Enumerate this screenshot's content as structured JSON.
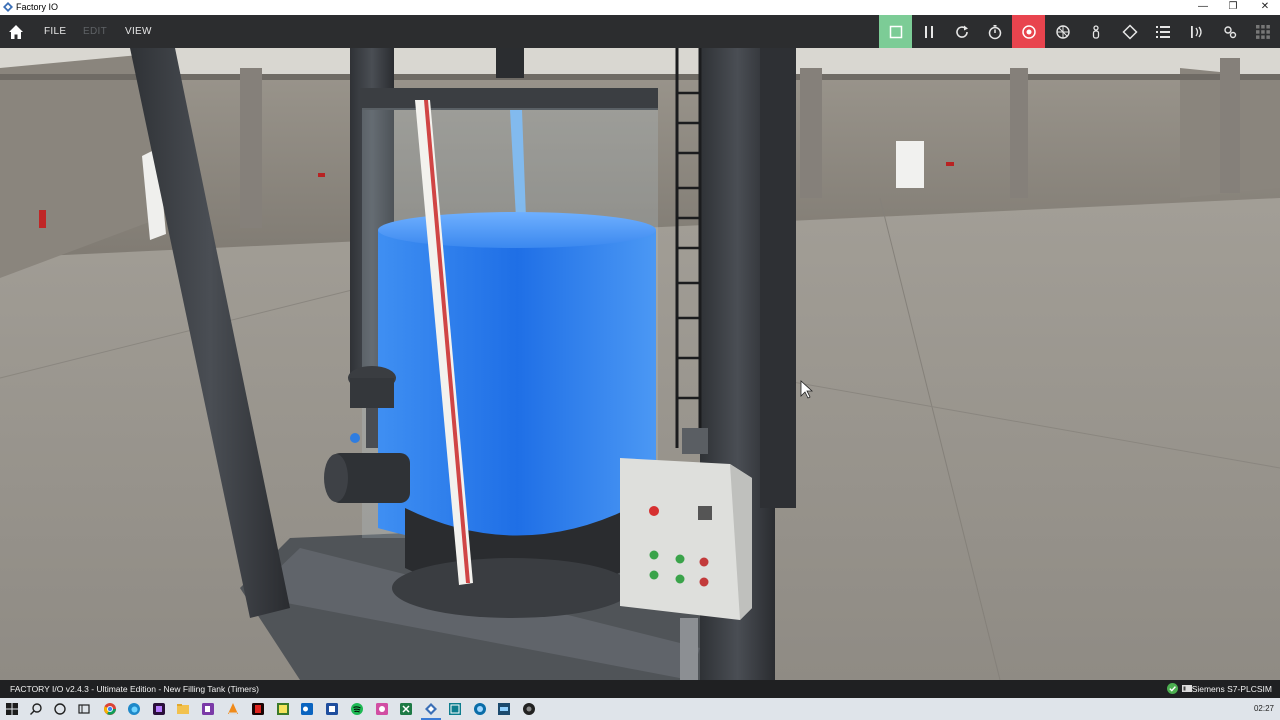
{
  "window": {
    "title": "Factory IO",
    "minimize_glyph": "—",
    "restore_glyph": "❐",
    "close_glyph": "✕"
  },
  "menu": {
    "file": "FILE",
    "edit": "EDIT",
    "view": "VIEW"
  },
  "toolbar_icons": [
    "play-icon",
    "pause-icon",
    "reset-icon",
    "timer-icon",
    "camera-orbit-icon",
    "fly-camera-icon",
    "first-person-icon",
    "selection-icon",
    "list-icon",
    "sensors-icon",
    "drivers-icon",
    "grid-icon"
  ],
  "status": {
    "left": "FACTORY I/O v2.4.3 - Ultimate Edition - New Filling Tank (Timers)",
    "right": "Siemens S7-PLCSIM"
  },
  "taskbar": {
    "clock": "02:27",
    "apps": [
      "start-icon",
      "search-icon",
      "cortana-icon",
      "task-view-icon",
      "chrome-icon",
      "edge-icon",
      "premiere-icon",
      "file-explorer-icon",
      "onenote-icon",
      "vlc-icon",
      "acrobat-icon",
      "sticky-notes-icon",
      "outlook-icon",
      "word-icon",
      "spotify-icon",
      "photos-icon",
      "excel-icon",
      "factory-io-icon",
      "tia-portal-icon",
      "simatic-icon",
      "plcsim-icon",
      "obs-icon"
    ]
  },
  "colors": {
    "accent_green": "#7ccc96",
    "accent_red": "#e8444e",
    "toolbar_bg": "#2c2d2f",
    "water": "#2f80ea"
  }
}
